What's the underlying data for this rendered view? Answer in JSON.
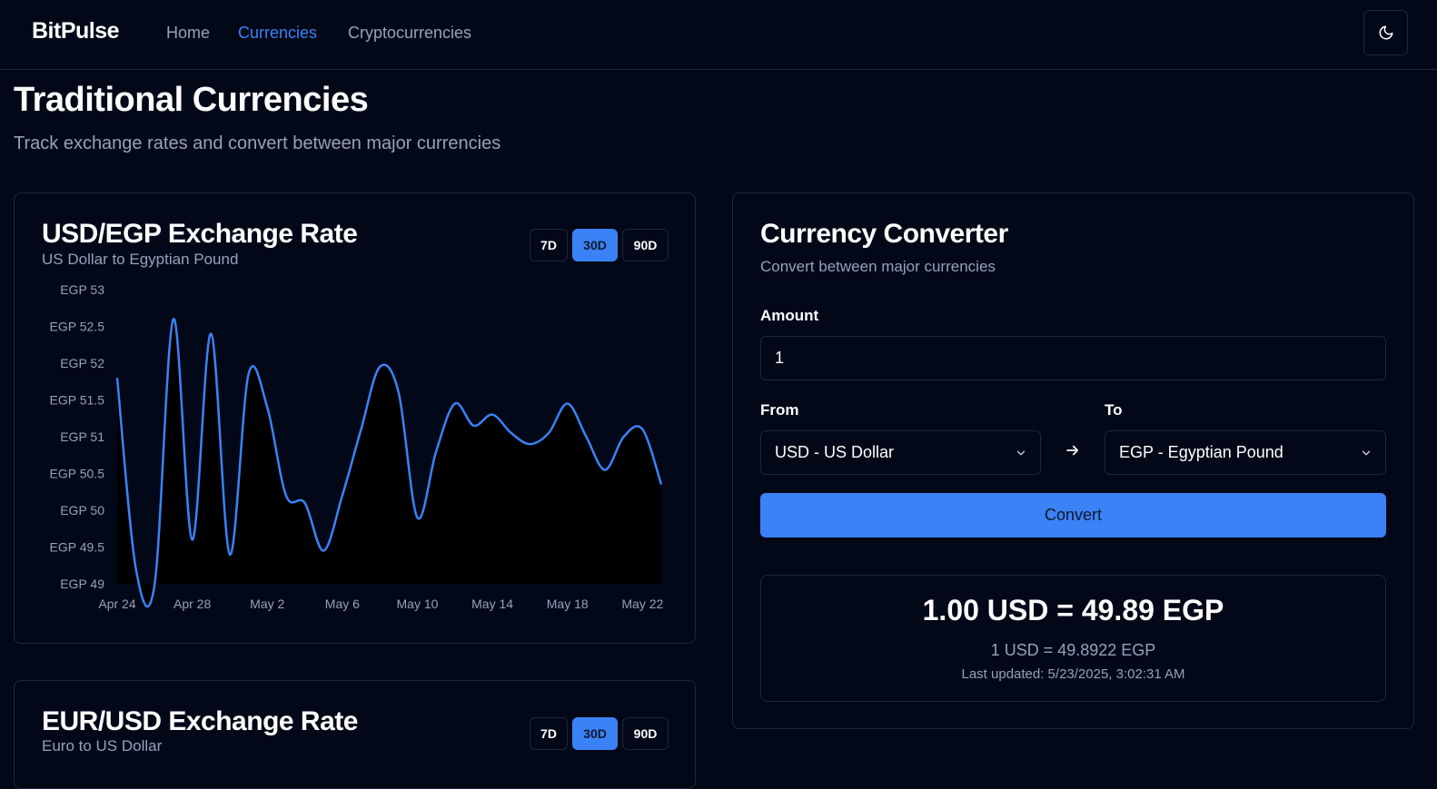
{
  "nav": {
    "brand": "BitPulse",
    "links": [
      {
        "label": "Home",
        "active": false
      },
      {
        "label": "Currencies",
        "active": true
      },
      {
        "label": "Cryptocurrencies",
        "active": false
      }
    ],
    "theme_icon": "moon-icon"
  },
  "page": {
    "title": "Traditional Currencies",
    "subtitle": "Track exchange rates and convert between major currencies"
  },
  "usd_egp_card": {
    "title": "USD/EGP Exchange Rate",
    "subtitle": "US Dollar to Egyptian Pound",
    "ranges": [
      "7D",
      "30D",
      "90D"
    ],
    "active_range": "30D"
  },
  "eur_usd_card": {
    "title": "EUR/USD Exchange Rate",
    "subtitle": "Euro to US Dollar",
    "ranges": [
      "7D",
      "30D",
      "90D"
    ],
    "active_range": "30D"
  },
  "converter": {
    "title": "Currency Converter",
    "subtitle": "Convert between major currencies",
    "amount_label": "Amount",
    "amount_value": "1",
    "from_label": "From",
    "from_value": "USD - US Dollar",
    "to_label": "To",
    "to_value": "EGP - Egyptian Pound",
    "convert_label": "Convert",
    "result_main": "1.00 USD = 49.89 EGP",
    "result_rate": "1 USD = 49.8922 EGP",
    "result_updated": "Last updated: 5/23/2025, 3:02:31 AM"
  },
  "colors": {
    "accent": "#3b82f6",
    "background": "#020817",
    "border": "#1e293b",
    "muted_text": "#94a3b8"
  },
  "chart_data": {
    "type": "area",
    "title": "USD/EGP Exchange Rate",
    "subtitle": "US Dollar to Egyptian Pound",
    "x_tick_labels": [
      "Apr 24",
      "Apr 28",
      "May 2",
      "May 6",
      "May 10",
      "May 14",
      "May 18",
      "May 22"
    ],
    "y_tick_labels": [
      "EGP 49",
      "EGP 49.5",
      "EGP 50",
      "EGP 50.5",
      "EGP 51",
      "EGP 51.5",
      "EGP 52",
      "EGP 52.5",
      "EGP 53"
    ],
    "ylim": [
      49,
      53
    ],
    "x_start": "Apr 24",
    "series": [
      {
        "values": [
          51.8,
          49.2,
          49.0,
          52.6,
          49.6,
          52.4,
          49.4,
          51.85,
          51.4,
          50.2,
          50.1,
          49.45,
          50.2,
          51.1,
          51.95,
          51.6,
          49.9,
          50.8,
          51.45,
          51.15,
          51.3,
          51.05,
          50.9,
          51.05,
          51.45,
          51.0,
          50.55,
          51.0,
          51.1,
          50.35
        ]
      }
    ],
    "grid": false,
    "legend": "none"
  }
}
